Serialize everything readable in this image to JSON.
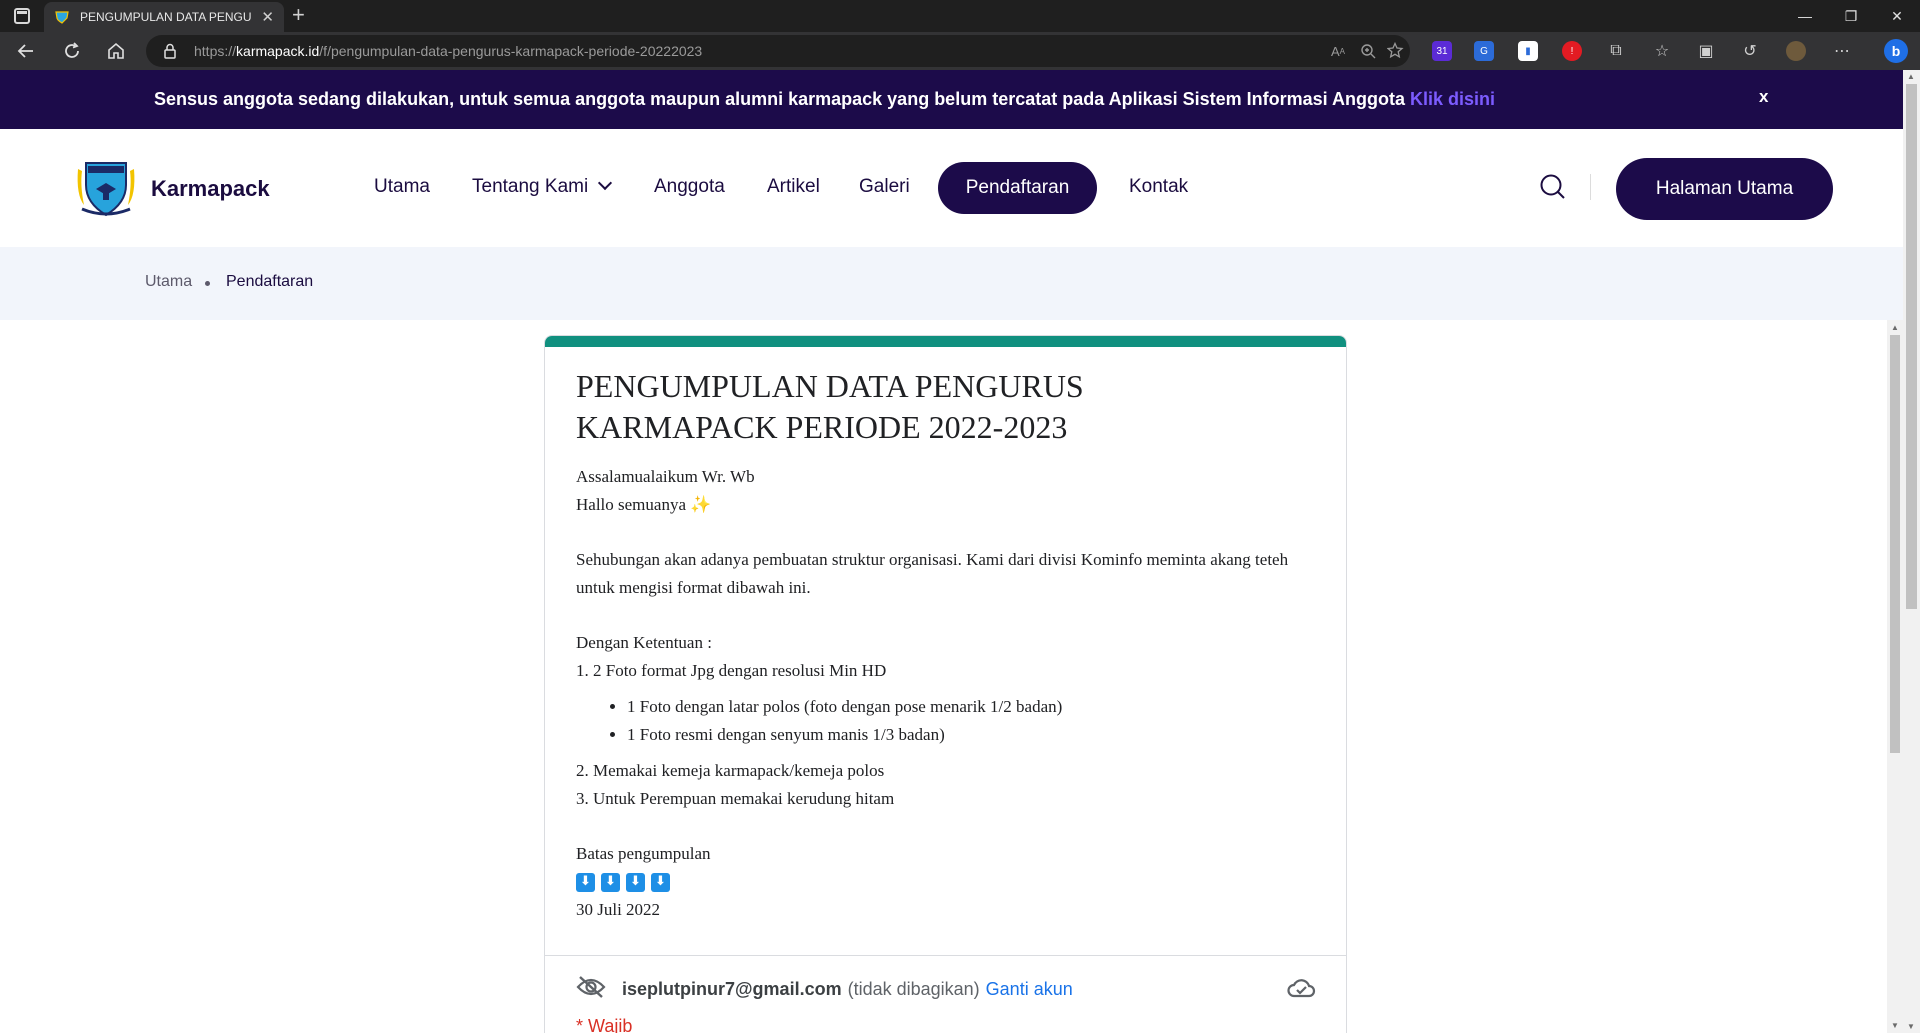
{
  "browser": {
    "tab_title": "PENGUMPULAN DATA PENGURU",
    "url_scheme": "https://",
    "url_domain": "karmapack.id",
    "url_path": "/f/pengumpulan-data-pengurus-karmapack-periode-20222023",
    "ext_badge": "31"
  },
  "banner": {
    "text": "Sensus anggota sedang dilakukan, untuk semua anggota maupun alumni karmapack yang belum tercatat pada Aplikasi Sistem Informasi Anggota",
    "link_label": "Klik disini",
    "close_label": "x",
    "link_color": "#7c5cff",
    "background": "#1c0b4a"
  },
  "site": {
    "logo_text": "Karmapack",
    "nav": {
      "utama": "Utama",
      "tentang": "Tentang Kami",
      "anggota": "Anggota",
      "artikel": "Artikel",
      "galeri": "Galeri",
      "pendaftaran": "Pendaftaran",
      "kontak": "Kontak"
    },
    "cta_label": "Halaman Utama"
  },
  "breadcrumb": {
    "home": "Utama",
    "current": "Pendaftaran"
  },
  "form": {
    "accent_color": "#10907f",
    "title_line1": "PENGUMPULAN DATA PENGURUS",
    "title_line2": "KARMAPACK PERIODE 2022-2023",
    "greeting": "Assalamualaikum Wr. Wb",
    "hello": "Hallo semuanya ✨",
    "intro": "Sehubungan akan adanya pembuatan struktur organisasi. Kami dari divisi Kominfo meminta akang teteh untuk mengisi format dibawah ini.",
    "rules_heading": "Dengan Ketentuan :",
    "rule1": "1. 2 Foto format Jpg dengan resolusi Min HD",
    "rule1_bullets": [
      "1 Foto dengan latar polos (foto dengan pose menarik 1/2 badan)",
      "1 Foto resmi dengan senyum manis 1/3 badan)"
    ],
    "rule2": "2. Memakai kemeja karmapack/kemeja polos",
    "rule3": "3. Untuk Perempuan memakai kerudung hitam",
    "deadline_label": "Batas pengumpulan",
    "arrow_glyph": "⬇",
    "deadline_date": "30 Juli 2022",
    "account_email": "iseplutpinur7@gmail.com",
    "account_note": "(tidak dibagikan)",
    "account_switch": "Ganti akun",
    "required_label": "* Wajib"
  }
}
